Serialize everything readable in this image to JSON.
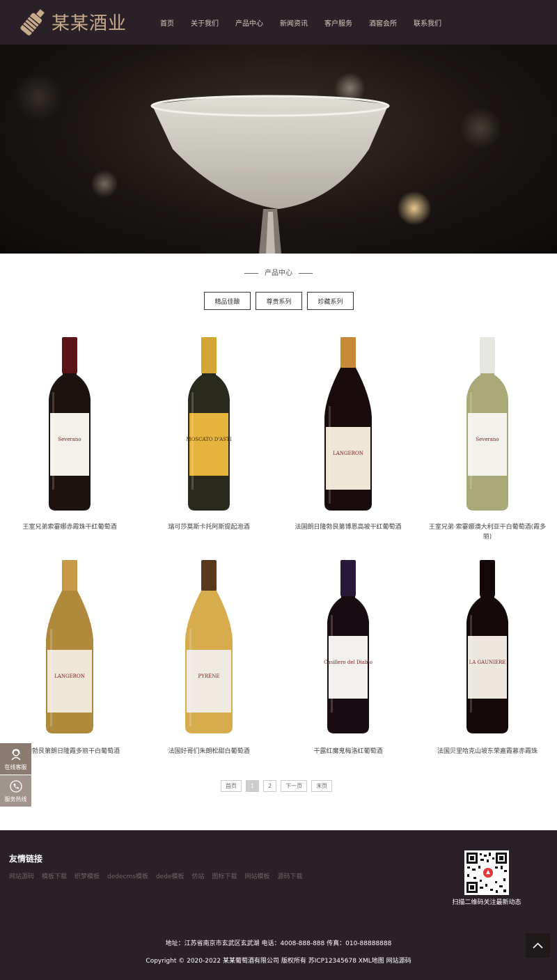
{
  "header": {
    "logo_text": "某某酒业",
    "nav": [
      "首页",
      "关于我们",
      "产品中心",
      "新闻资讯",
      "客户服务",
      "酒窖会所",
      "联系我们"
    ]
  },
  "section": {
    "title": "产品中心",
    "tabs": [
      "精品佳酿",
      "尊贵系列",
      "珍藏系列"
    ]
  },
  "products": [
    {
      "name": "王室兄弟索霎娜赤霞珠干红葡萄酒",
      "label": "Severano",
      "glass": "#1c1210",
      "cap": "#5a1418",
      "label_color": "#f4f0ea"
    },
    {
      "name": "瑞可莎莫斯卡托阿斯提起泡酒",
      "label": "MOSCATO D'ASTI",
      "glass": "#2a2a1c",
      "cap": "#d2a534",
      "label_color": "#e6b43c"
    },
    {
      "name": "法国朗日隆勃艮第博恩高坡干红葡萄酒",
      "label": "LANGERON",
      "glass": "#1a0c0c",
      "cap": "#c88a38",
      "label_color": "#efe6d6"
    },
    {
      "name": "王室兄弟·索霎娜澳大利亚干白葡萄酒(霞多丽)",
      "label": "Severano",
      "glass": "#a8a878",
      "cap": "#e8e6e0",
      "label_color": "#f4f2ec"
    },
    {
      "name": "法国勃艮第朗日隆霞多丽干白葡萄酒",
      "label": "LANGERON",
      "glass": "#b08a3c",
      "cap": "#c89a48",
      "label_color": "#efe6d6"
    },
    {
      "name": "法国好哥们朱朗松甜白葡萄酒",
      "label": "PYRÈNE",
      "glass": "#d6ac4c",
      "cap": "#5a3a1e",
      "label_color": "#efebe2"
    },
    {
      "name": "干露红魔鬼梅洛红葡萄酒",
      "label": "Casillero del Diablo",
      "glass": "#180c12",
      "cap": "#2a1838",
      "label_color": "#f2f0ec"
    },
    {
      "name": "法国贝里哈克山坡东荣嘉霞慕赤霞珠",
      "label": "LA GAUNIERE",
      "glass": "#140808",
      "cap": "#140808",
      "label_color": "#ece8e0"
    }
  ],
  "pager": [
    "首页",
    "1",
    "2",
    "下一页",
    "末页"
  ],
  "float": {
    "service": "在线客服",
    "hotline": "服务热线"
  },
  "footer": {
    "links_title": "友情链接",
    "links": [
      "网站源码",
      "模板下载",
      "织梦模板",
      "dedecms模板",
      "dede模板",
      "仿站",
      "图标下载",
      "网站模板",
      "源码下载"
    ],
    "qr_text": "扫描二维码关注最新动态",
    "address": "地址：江苏省南京市玄武区玄武湖 电话：4008-888-888 传真：010-88888888",
    "copyright": "Copyright © 2020-2022 某某葡萄酒有限公司 版权所有  苏ICP12345678 XML地图 网站源码"
  },
  "colors": {
    "header_bg": "#2a2028",
    "logo": "#c8aa8a",
    "float_bg": "#8b7b71"
  }
}
